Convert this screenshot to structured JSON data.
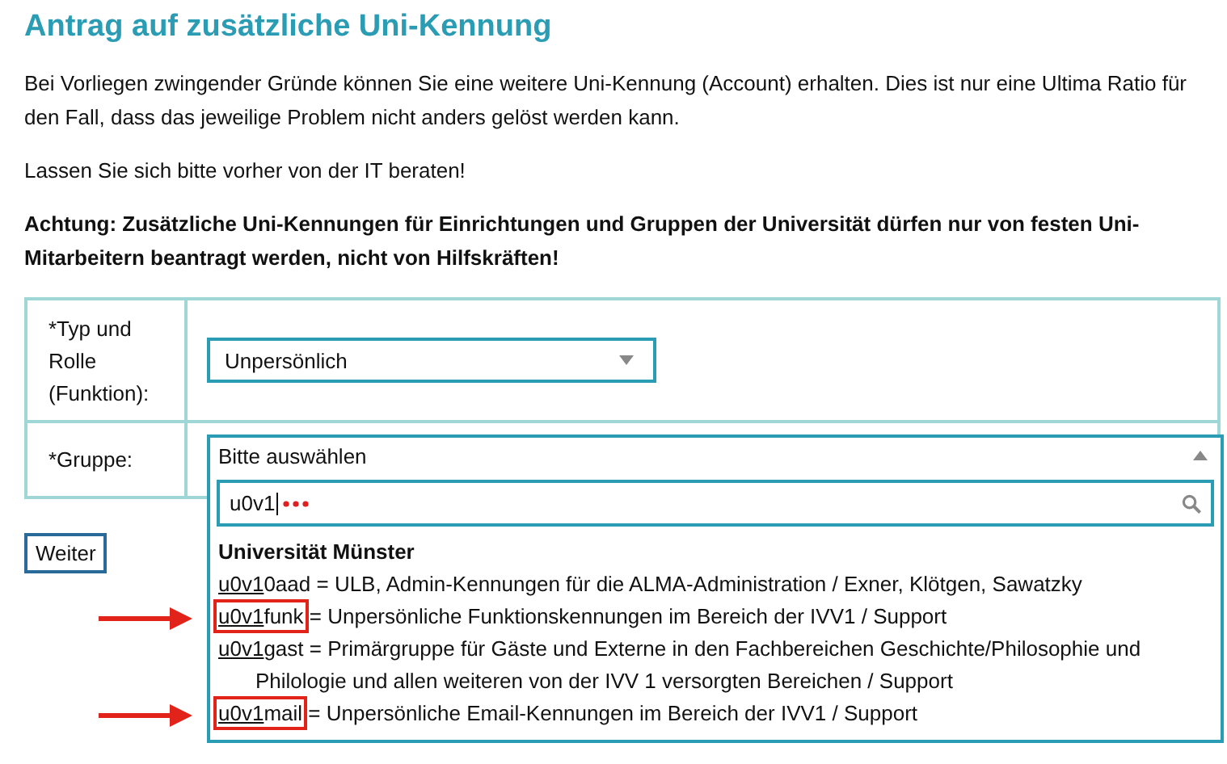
{
  "title": "Antrag auf zusätzliche Uni-Kennung",
  "paragraphs": [
    {
      "text": "Bei Vorliegen zwingender Gründe können Sie eine weitere Uni-Kennung (Account) erhalten. Dies ist nur eine Ultima Ratio für den Fall, dass das jeweilige Problem nicht anders gelöst werden kann.",
      "bold": false
    },
    {
      "text": "Lassen Sie sich bitte vorher von der IT beraten!",
      "bold": false
    },
    {
      "text": "Achtung: Zusätzliche Uni-Kennungen für Einrichtungen und Gruppen der Universität dürfen nur von festen Uni-Mitarbeitern beantragt werden, nicht von Hilfskräften!",
      "bold": true
    }
  ],
  "form": {
    "rows": [
      {
        "label": "*Typ und Rolle (Funktion):",
        "value": "Unpersönlich",
        "expanded": false
      },
      {
        "label": "*Gruppe:",
        "value": "Bitte auswählen",
        "expanded": true
      }
    ]
  },
  "dropdown": {
    "search_value": "u0v1",
    "loading": true,
    "group": "Universität Münster",
    "options": [
      {
        "match": "u0v1",
        "rest": "0aad",
        "text": "= ULB, Admin-Kennungen für die ALMA-Administration / Exner, Klötgen, Sawatzky",
        "highlighted": false
      },
      {
        "match": "u0v1",
        "rest": "funk",
        "text": "= Unpersönliche Funktionskennungen im Bereich der IVV1 / Support",
        "highlighted": true
      },
      {
        "match": "u0v1",
        "rest": "gast",
        "text": "= Primärgruppe für Gäste und Externe in den Fachbereichen Geschichte/Philosophie und Philologie und allen weiteren von der IVV 1 versorgten Bereichen / Support",
        "highlighted": false
      },
      {
        "match": "u0v1",
        "rest": "mail",
        "text": "= Unpersönliche Email-Kennungen im Bereich der IVV1 / Support",
        "highlighted": true
      }
    ]
  },
  "button": "Weiter"
}
